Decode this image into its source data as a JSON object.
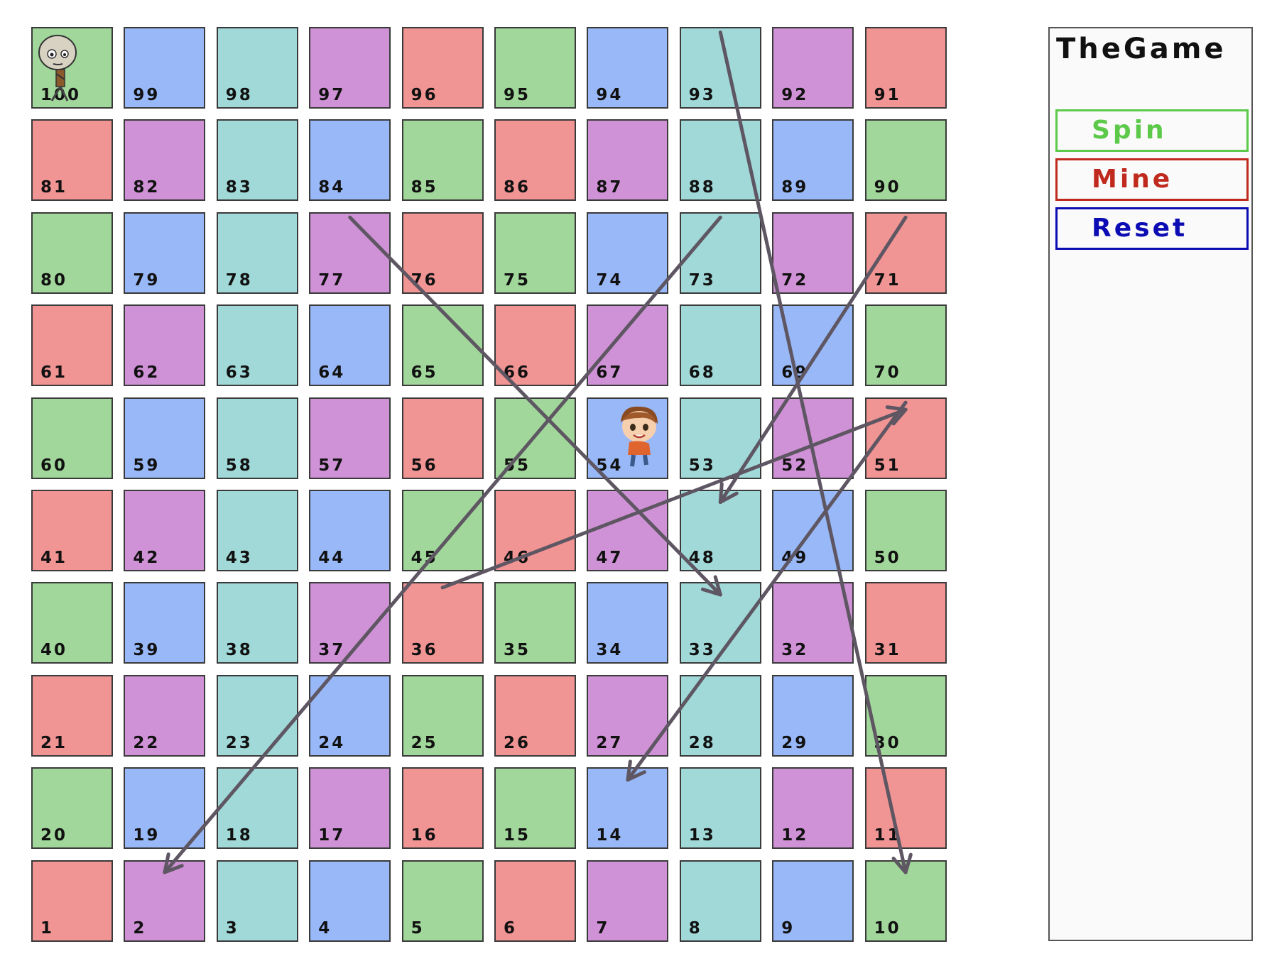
{
  "game": {
    "board": {
      "rows": [
        [
          100,
          99,
          98,
          97,
          96,
          95,
          94,
          93,
          92,
          91
        ],
        [
          81,
          82,
          83,
          84,
          85,
          86,
          87,
          88,
          89,
          90
        ],
        [
          80,
          79,
          78,
          77,
          76,
          75,
          74,
          73,
          72,
          71
        ],
        [
          61,
          62,
          63,
          64,
          65,
          66,
          67,
          68,
          69,
          70
        ],
        [
          60,
          59,
          58,
          57,
          56,
          55,
          54,
          53,
          52,
          51
        ],
        [
          41,
          42,
          43,
          44,
          45,
          46,
          47,
          48,
          49,
          50
        ],
        [
          40,
          39,
          38,
          37,
          36,
          35,
          34,
          33,
          32,
          31
        ],
        [
          21,
          22,
          23,
          24,
          25,
          26,
          27,
          28,
          29,
          30
        ],
        [
          20,
          19,
          18,
          17,
          16,
          15,
          14,
          13,
          12,
          11
        ],
        [
          1,
          2,
          3,
          4,
          5,
          6,
          7,
          8,
          9,
          10
        ]
      ],
      "colors": {
        "green": "#a1d79a",
        "blue": "#99b8f7",
        "teal": "#a1d8d8",
        "purple": "#d092d6",
        "red": "#f09494"
      },
      "color_cycle": [
        "red",
        "purple",
        "teal",
        "blue",
        "green"
      ],
      "arrow_color": "#5e5662"
    },
    "jumps": [
      {
        "from": 93,
        "to": 10
      },
      {
        "from": 77,
        "to": 33
      },
      {
        "from": 73,
        "to": 2
      },
      {
        "from": 71,
        "to": 48
      },
      {
        "from": 36,
        "to": 51
      },
      {
        "from": 51,
        "to": 14
      }
    ],
    "tokens": [
      {
        "name": "zombie-token",
        "square": 100
      },
      {
        "name": "boy-token",
        "square": 54
      }
    ]
  },
  "panel": {
    "title": "TheGame",
    "buttons": [
      {
        "label": "Spin",
        "color": "#5dc94a"
      },
      {
        "label": "Mine",
        "color": "#c02a1e"
      },
      {
        "label": "Reset",
        "color": "#0c0cb4"
      }
    ]
  }
}
